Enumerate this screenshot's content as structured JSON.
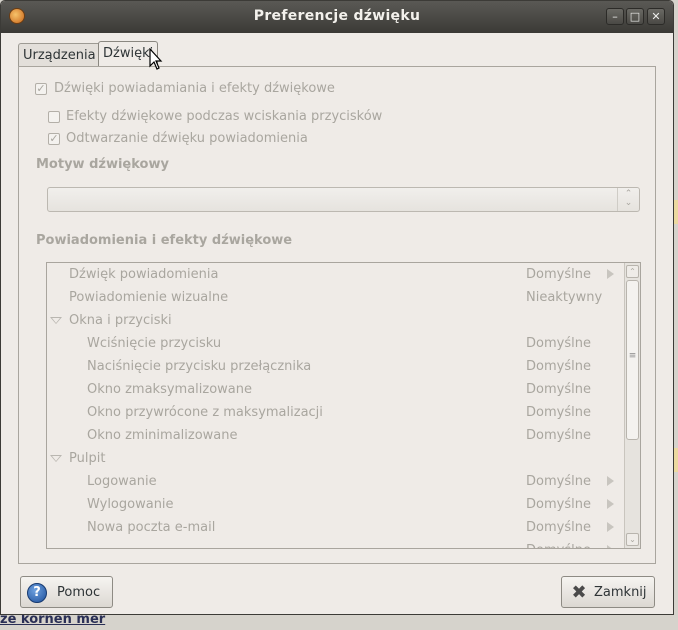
{
  "window": {
    "title": "Preferencje dźwięku"
  },
  "tabs": [
    "Urządzenia",
    "Dźwięki"
  ],
  "options": {
    "main": "Dźwięki powiadamiania i efekty dźwiękowe",
    "button_sounds": "Efekty dźwiękowe podczas wciskania przycisków",
    "notification_playback": "Odtwarzanie dźwięku powiadomienia"
  },
  "theme": {
    "heading": "Motyw dźwiękowy",
    "value": ""
  },
  "events": {
    "heading": "Powiadomienia i efekty dźwiękowe",
    "rows": [
      {
        "name": "Dźwięk powiadomienia",
        "value": "Domyślne"
      },
      {
        "name": "Powiadomienie wizualne",
        "value": "Nieaktywny"
      },
      {
        "name": "Okna i przyciski",
        "value": ""
      },
      {
        "name": "Wciśnięcie przycisku",
        "value": "Domyślne"
      },
      {
        "name": "Naciśnięcie przycisku przełącznika",
        "value": "Domyślne"
      },
      {
        "name": "Okno zmaksymalizowane",
        "value": "Domyślne"
      },
      {
        "name": "Okno przywrócone z maksymalizacji",
        "value": "Domyślne"
      },
      {
        "name": "Okno zminimalizowane",
        "value": "Domyślne"
      },
      {
        "name": "Pulpit",
        "value": ""
      },
      {
        "name": "Logowanie",
        "value": "Domyślne"
      },
      {
        "name": "Wylogowanie",
        "value": "Domyślne"
      },
      {
        "name": "Nowa poczta e-mail",
        "value": "Domyślne"
      },
      {
        "name": "",
        "value": "Domyślne"
      }
    ]
  },
  "buttons": {
    "help": "Pomoc",
    "close": "Zamknij"
  },
  "background": {
    "link": "ze kornen mer"
  }
}
